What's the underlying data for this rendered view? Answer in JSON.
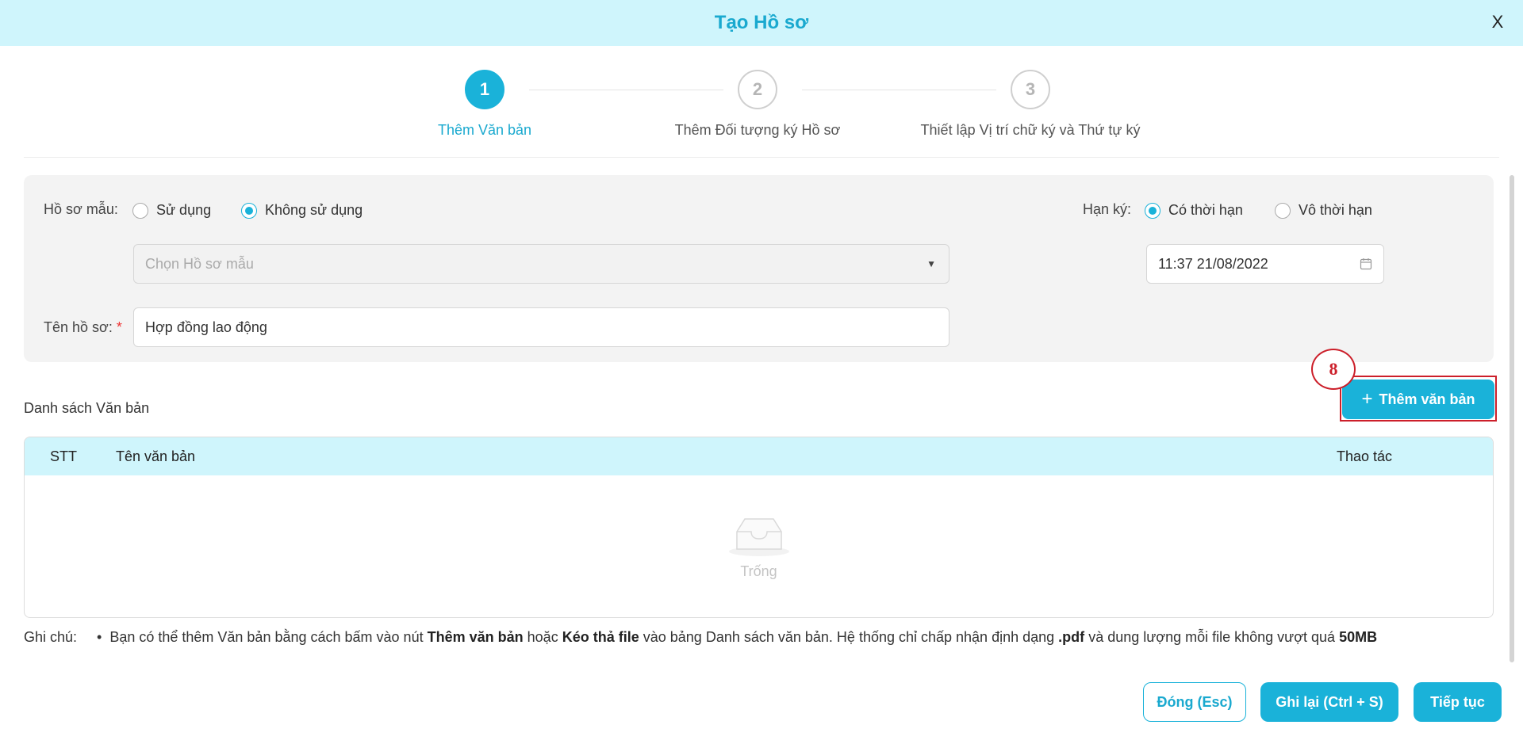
{
  "header": {
    "title": "Tạo Hồ sơ",
    "close": "X"
  },
  "steps": [
    {
      "number": "1",
      "label": "Thêm Văn bản",
      "active": true
    },
    {
      "number": "2",
      "label": "Thêm Đối tượng ký Hồ sơ",
      "active": false
    },
    {
      "number": "3",
      "label": "Thiết lập Vị trí chữ ký và Thứ tự ký",
      "active": false
    }
  ],
  "form": {
    "template_label": "Hồ sơ mẫu:",
    "template_options": [
      "Sử dụng",
      "Không sử dụng"
    ],
    "template_selected": "Không sử dụng",
    "template_select_placeholder": "Chọn Hồ sơ mẫu",
    "name_label": "Tên hồ sơ:",
    "name_required": "*",
    "name_value": "Hợp đồng lao động",
    "deadline_label": "Hạn ký:",
    "deadline_options": [
      "Có thời hạn",
      "Vô thời hạn"
    ],
    "deadline_selected": "Có thời hạn",
    "deadline_value": "11:37 21/08/2022"
  },
  "documents": {
    "title": "Danh sách Văn bản",
    "add_button": "Thêm văn bản",
    "annotation": "8",
    "columns": {
      "index": "STT",
      "name": "Tên văn bản",
      "actions": "Thao tác"
    },
    "empty_text": "Trống"
  },
  "note": {
    "label": "Ghi chú:",
    "bullet": "•",
    "parts": {
      "p1": "Bạn có thể thêm Văn bản bằng cách bấm vào nút",
      "b1": "Thêm văn bản",
      "p2": "hoặc",
      "b2": "Kéo thả file",
      "p3": "vào bảng Danh sách văn bản. Hệ thống chỉ chấp nhận định dạng",
      "b3": ".pdf",
      "p4": "và dung lượng mỗi file không vượt quá",
      "b4": "50MB"
    }
  },
  "footer": {
    "close_button": "Đóng (Esc)",
    "save_button": "Ghi lại (Ctrl + S)",
    "next_button": "Tiếp tục"
  },
  "colors": {
    "accent": "#1ab2d9",
    "header_bg": "#cff5fc",
    "annotation": "#cc1f2a"
  }
}
